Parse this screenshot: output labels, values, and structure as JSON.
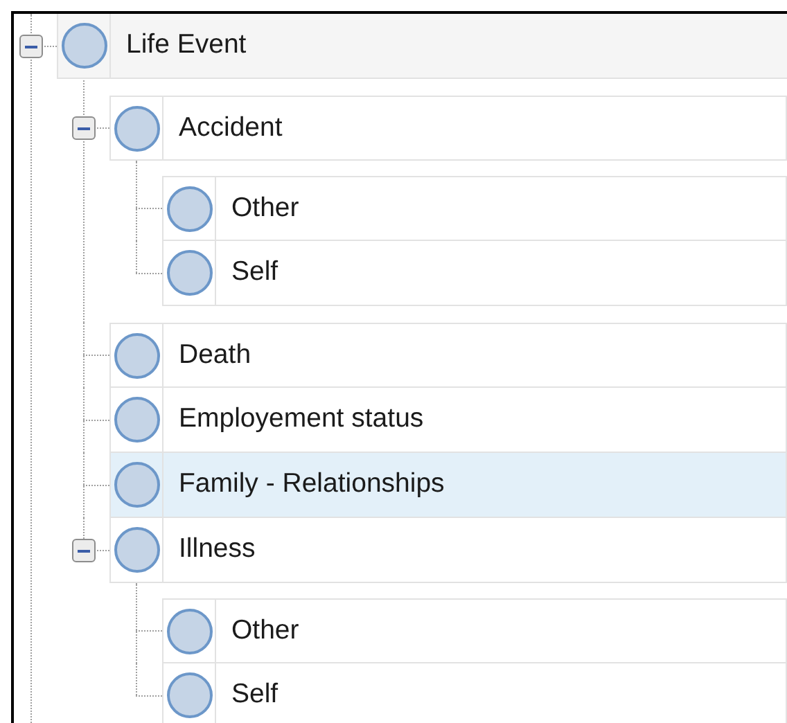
{
  "tree": [
    {
      "label": "Life Event",
      "selected": false,
      "expanded": true,
      "children": [
        {
          "label": "Accident",
          "selected": false,
          "expanded": true,
          "children": [
            {
              "label": "Other",
              "selected": false
            },
            {
              "label": "Self",
              "selected": false
            }
          ]
        },
        {
          "label": "Death",
          "selected": false
        },
        {
          "label": "Employement status",
          "selected": false
        },
        {
          "label": "Family - Relationships",
          "selected": true
        },
        {
          "label": "Illness",
          "selected": false,
          "expanded": true,
          "children": [
            {
              "label": "Other",
              "selected": false
            },
            {
              "label": "Self",
              "selected": false
            }
          ]
        }
      ]
    }
  ]
}
